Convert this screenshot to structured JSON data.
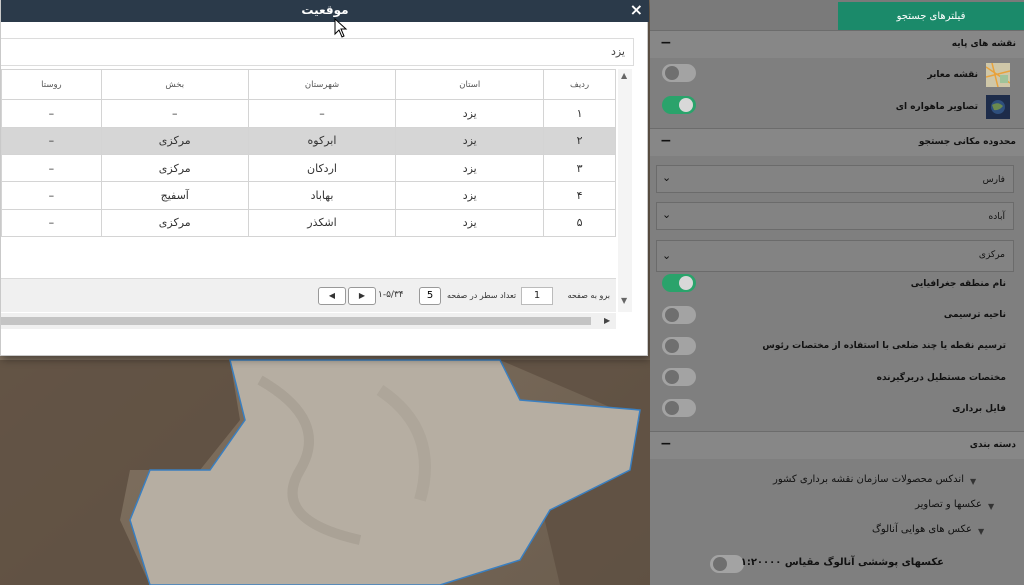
{
  "dialog": {
    "title": "موقعیت",
    "close_icon": "×",
    "search_value": "یزد",
    "columns": [
      "ردیف",
      "استان",
      "شهرستان",
      "بخش",
      "روستا"
    ],
    "rows": [
      {
        "index": "۱",
        "province": "یزد",
        "county": "–",
        "district": "–",
        "village": "–"
      },
      {
        "index": "۲",
        "province": "یزد",
        "county": "ابرکوه",
        "district": "مرکزی",
        "village": "–"
      },
      {
        "index": "۳",
        "province": "یزد",
        "county": "اردکان",
        "district": "مرکزی",
        "village": "–"
      },
      {
        "index": "۴",
        "province": "یزد",
        "county": "بهاباد",
        "district": "آسفیج",
        "village": "–"
      },
      {
        "index": "۵",
        "province": "یزد",
        "county": "اشکذر",
        "district": "مرکزی",
        "village": "–"
      }
    ],
    "selected_row": 1,
    "pager": {
      "goto_label": "برو به صفحه",
      "goto_value": "1",
      "rows_label": "تعداد سطر در صفحه",
      "rows_value": "5",
      "range_text": "۱-۵/۳۴",
      "prev_icon": "◀",
      "next_icon": "▶"
    }
  },
  "panel": {
    "tab_label": "فیلترهای جستجو",
    "base_maps": {
      "title": "نقشه های پایه",
      "items": [
        {
          "label": "نقشه معابر",
          "on": false
        },
        {
          "label": "تصاویر ماهواره ای",
          "on": true
        }
      ]
    },
    "spatial": {
      "title": "محدوده مکانی جستجو",
      "dropdowns": [
        "فارس",
        "آباده",
        "مرکزی"
      ],
      "options": [
        {
          "label": "نام منطقه جغرافیایی",
          "on": true
        },
        {
          "label": "ناحیه ترسیمی",
          "on": false
        },
        {
          "label": "ترسیم نقطه یا چند ضلعی با استفاده از مختصات رئوس",
          "on": false
        },
        {
          "label": "مختصات مستطیل دربرگیرنده",
          "on": false
        },
        {
          "label": "فایل برداری",
          "on": false
        }
      ]
    },
    "category": {
      "title": "دسته بندی",
      "tree": [
        "اندکس محصولات سازمان نقشه برداری کشور",
        "عکسها و تصاویر",
        "عکس های هوایی آنالوگ"
      ],
      "leaf": {
        "label": "عکسهای پوششی آنالوگ مقیاس ۱:۲۰۰۰۰",
        "on": false
      }
    }
  }
}
